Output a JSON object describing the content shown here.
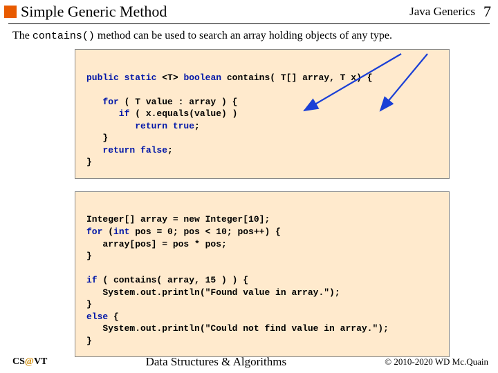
{
  "header": {
    "title": "Simple Generic Method",
    "right": "Java Generics",
    "page": "7"
  },
  "intro": {
    "pre": "The ",
    "mono": "contains()",
    "post": " method can be used to search an array holding objects of any type."
  },
  "code1": {
    "l1a": "public static ",
    "l1b": "<T> ",
    "l1c": "boolean ",
    "l1d": "contains( T[] array, T x) {",
    "l2": "",
    "l3a": "   for ",
    "l3b": "( T value : array ) {",
    "l4a": "      if ",
    "l4b": "( x.equals(value) )",
    "l5a": "         return true",
    "l5b": ";",
    "l6": "   }",
    "l7a": "   return false",
    "l7b": ";",
    "l8": "}"
  },
  "code2": {
    "l1": "Integer[] array = new Integer[10];",
    "l2a": "for ",
    "l2b": "(",
    "l2c": "int ",
    "l2d": "pos = 0; pos < 10; pos++) {",
    "l3": "   array[pos] = pos * pos;",
    "l4": "}",
    "l5": "",
    "l6a": "if ",
    "l6b": "( contains( array, 15 ) ) {",
    "l7": "   System.out.println(\"Found value in array.\");",
    "l8": "}",
    "l9a": "else ",
    "l9b": "{",
    "l10": "   System.out.println(\"Could not find value in array.\");",
    "l11": "}"
  },
  "footer": {
    "left_pre": "CS",
    "left_at": "@",
    "left_post": "VT",
    "center": "Data Structures & Algorithms",
    "right": "© 2010-2020 WD Mc.Quain"
  }
}
